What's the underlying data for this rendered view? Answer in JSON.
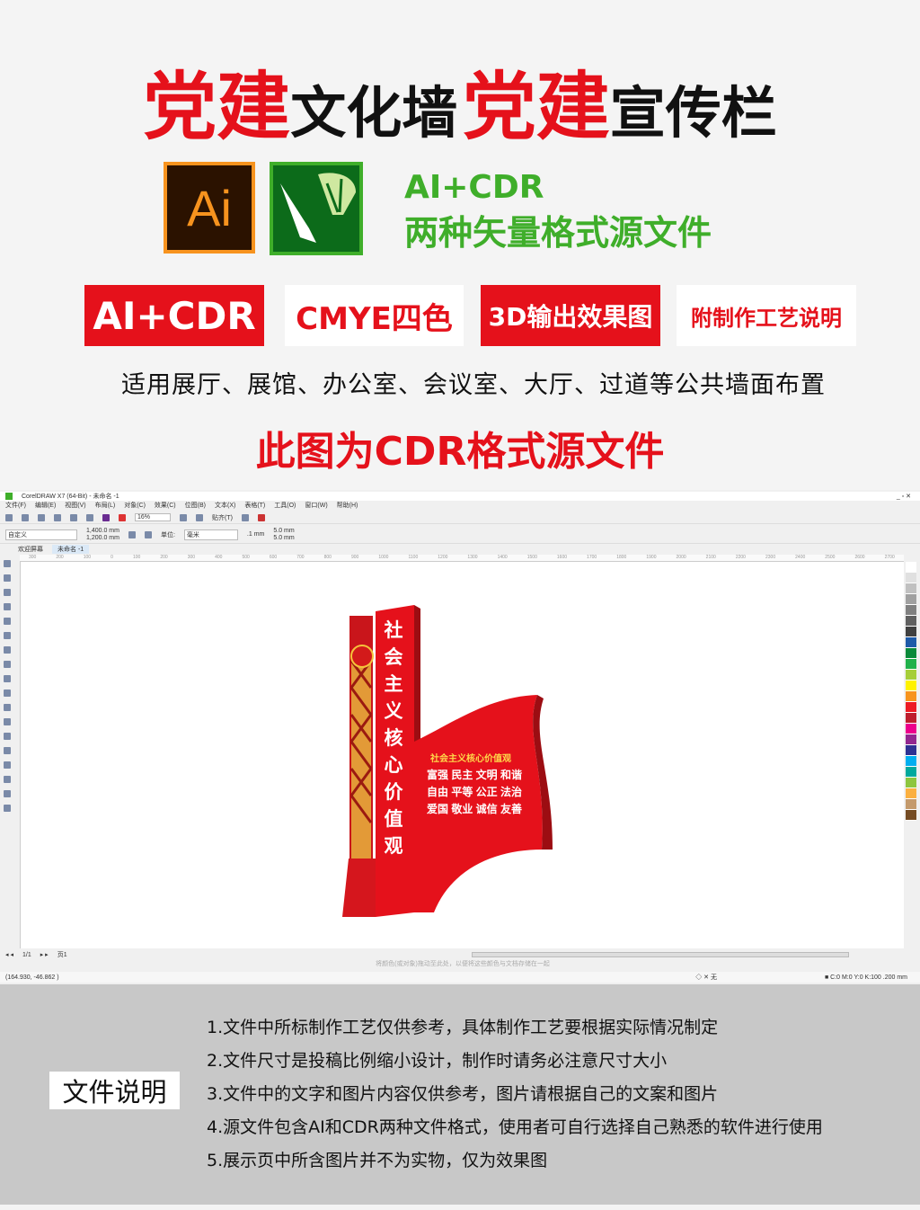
{
  "title": {
    "part1_red": "党建",
    "part1_black": "文化墙",
    "part2_red": "党建",
    "part2_black": "宣传栏"
  },
  "logos": {
    "ai_label": "Ai",
    "cdr_icon": "coreldraw-balloon-pen-icon"
  },
  "formats": {
    "line1": "AI+CDR",
    "line2": "两种矢量格式源文件"
  },
  "badges": [
    "AI+CDR",
    "CMYE四色",
    "3D输出效果图",
    "附制作工艺说明"
  ],
  "apply_text": "适用展厅、展馆、办公室、会议室、大厅、过道等公共墙面布置",
  "subtitle": "此图为CDR格式源文件",
  "coreldraw": {
    "window_title": "CorelDRAW X7 (64-Bit) - 未命名 -1",
    "menu": [
      "文件(F)",
      "编辑(E)",
      "视图(V)",
      "布局(L)",
      "对象(C)",
      "效果(C)",
      "位图(B)",
      "文本(X)",
      "表格(T)",
      "工具(O)",
      "窗口(W)",
      "帮助(H)"
    ],
    "zoom": "16%",
    "snap": "贴齐(T)",
    "page_preset": "自定义",
    "width": "1,400.0 mm",
    "height": "1,200.0 mm",
    "units_label": "单位:",
    "units": "毫米",
    "nudge": ".1 mm",
    "dup_x": "5.0 mm",
    "dup_y": "5.0 mm",
    "tabs": [
      "欢迎屏幕",
      "未命名 -1"
    ],
    "ruler": [
      "300",
      "200",
      "100",
      "0",
      "100",
      "200",
      "300",
      "400",
      "500",
      "600",
      "700",
      "800",
      "900",
      "1000",
      "1100",
      "1200",
      "1300",
      "1400",
      "1500",
      "1600",
      "1700",
      "1800",
      "1900",
      "2000",
      "2100",
      "2200",
      "2300",
      "2400",
      "2500",
      "2600",
      "2700"
    ],
    "page_nav": "1/1",
    "page_tab": "页1",
    "hint": "将颜色(或对象)拖动至此处，以便将这些颜色与文档存储在一起",
    "coords": "(164.930, -46.862 )",
    "fill_none": "无",
    "outline": "C:0 M:0 Y:0 K:100 .200 mm",
    "palette": [
      "#ffffff",
      "#e0e0e0",
      "#c0c0c0",
      "#a0a0a0",
      "#808080",
      "#606060",
      "#404040",
      "#1e5aa8",
      "#0a8a3a",
      "#20b14a",
      "#a6ce39",
      "#fff200",
      "#f7941d",
      "#ed1c24",
      "#be1e2d",
      "#ec008c",
      "#92278f",
      "#2e3192",
      "#00aeef",
      "#00a99d",
      "#8dc63f",
      "#fbb040",
      "#c49a6c",
      "#754c24"
    ]
  },
  "sign": {
    "vertical_text": "社会主义核心价值观",
    "panel_title": "社会主义核心价值观",
    "values": [
      "富强 民主 文明 和谐",
      "自由 平等 公正 法治",
      "爱国 敬业 诚信 友善"
    ]
  },
  "notes": {
    "label": "文件说明",
    "items": [
      "1.文件中所标制作工艺仅供参考，具体制作工艺要根据实际情况制定",
      "2.文件尺寸是投稿比例缩小设计，制作时请务必注意尺寸大小",
      "3.文件中的文字和图片内容仅供参考，图片请根据自己的文案和图片",
      "4.源文件包含AI和CDR两种文件格式，使用者可自行选择自己熟悉的软件进行使用",
      "5.展示页中所含图片并不为实物，仅为效果图"
    ]
  }
}
